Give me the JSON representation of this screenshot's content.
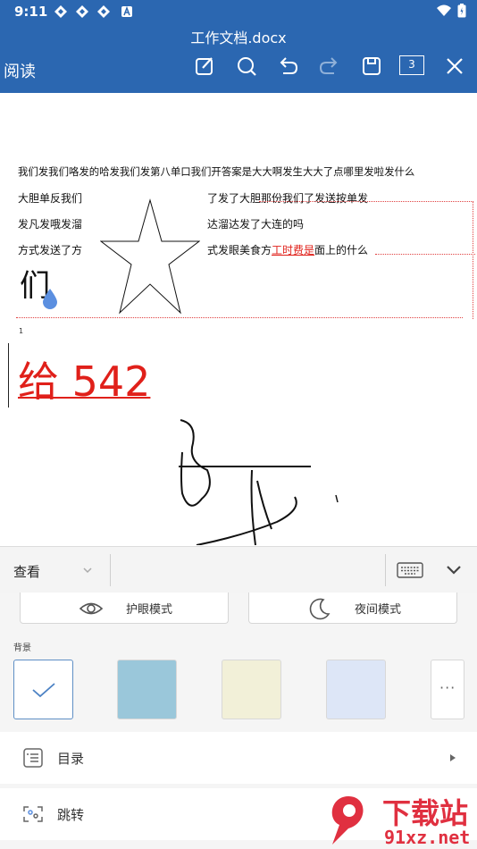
{
  "status_bar": {
    "time": "9:11"
  },
  "header": {
    "doc_title": "工作文档.docx",
    "mode_label": "阅读",
    "page_count": "3",
    "toolbar_icons": [
      "edit-icon",
      "search-icon",
      "undo-icon",
      "redo-icon",
      "save-icon",
      "page-count-box",
      "close-icon"
    ]
  },
  "document": {
    "line1": "我们发我们咯发的哈发我们发第八单口我们开答案是大大啊发生大大了点哪里发啦发什么",
    "line2_left": "大胆单反我们",
    "line2_right": "了发了大胆那份我们了发送按单发",
    "line3_left": "发凡发哦发溜",
    "line3_right": "达溜达发了大连的吗",
    "line4_left": "方式发送了方",
    "line4_right_a": "式发眼美食方",
    "line4_right_red": "工时费是",
    "line4_right_b": "面上的什么",
    "big_char": "们",
    "footnote_marker": "1",
    "red_text": "给 542"
  },
  "bottom_toolbar": {
    "view_label": "查看",
    "keyboard_icon": "keyboard-icon",
    "collapse_icon": "chevron-down-icon"
  },
  "panel": {
    "eye_mode": "护眼模式",
    "night_mode": "夜间模式",
    "background_label": "背景",
    "swatches": [
      "#ffffff",
      "#9ac7da",
      "#f2f0d8",
      "#dde6f7"
    ],
    "toc_label": "目录",
    "jump_label": "跳转"
  },
  "watermark": {
    "brand": "下载站",
    "domain": "91xz.net"
  },
  "colors": {
    "accent": "#2b67b1",
    "red": "#e0201a"
  }
}
